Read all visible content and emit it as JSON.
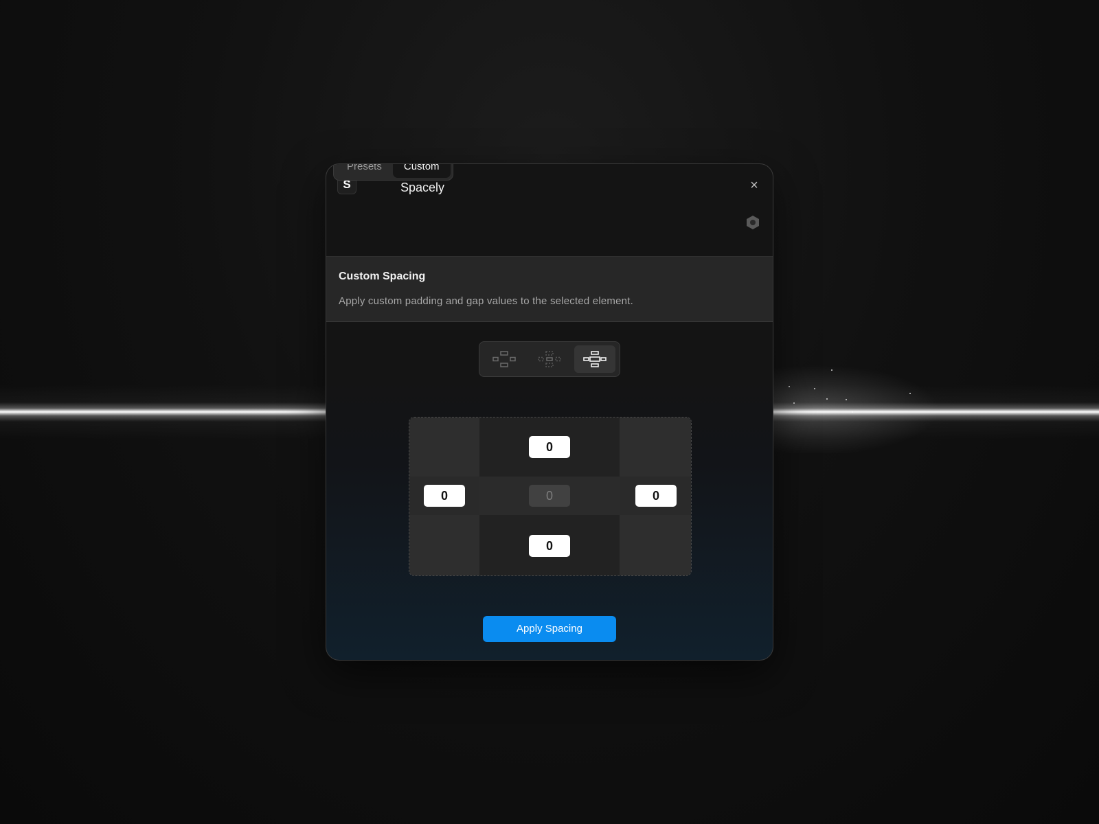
{
  "window": {
    "app_logo": "S",
    "title": "Spacely",
    "close_glyph": "×"
  },
  "tabs": [
    {
      "label": "Presets",
      "active": false
    },
    {
      "label": "Custom",
      "active": true
    }
  ],
  "section": {
    "title": "Custom Spacing",
    "description": "Apply custom padding and gap values to the selected element."
  },
  "modes": [
    {
      "icon": "padding-layout-icon",
      "active": false
    },
    {
      "icon": "gap-layout-icon",
      "active": false
    },
    {
      "icon": "padding-and-gap-layout-icon",
      "active": true
    }
  ],
  "spacing": {
    "top": "0",
    "left": "0",
    "center": "0",
    "right": "0",
    "bottom": "0"
  },
  "apply_button": "Apply Spacing",
  "colors": {
    "accent": "#0a8cf0",
    "panel": "#141414",
    "section_bg": "#272727"
  }
}
